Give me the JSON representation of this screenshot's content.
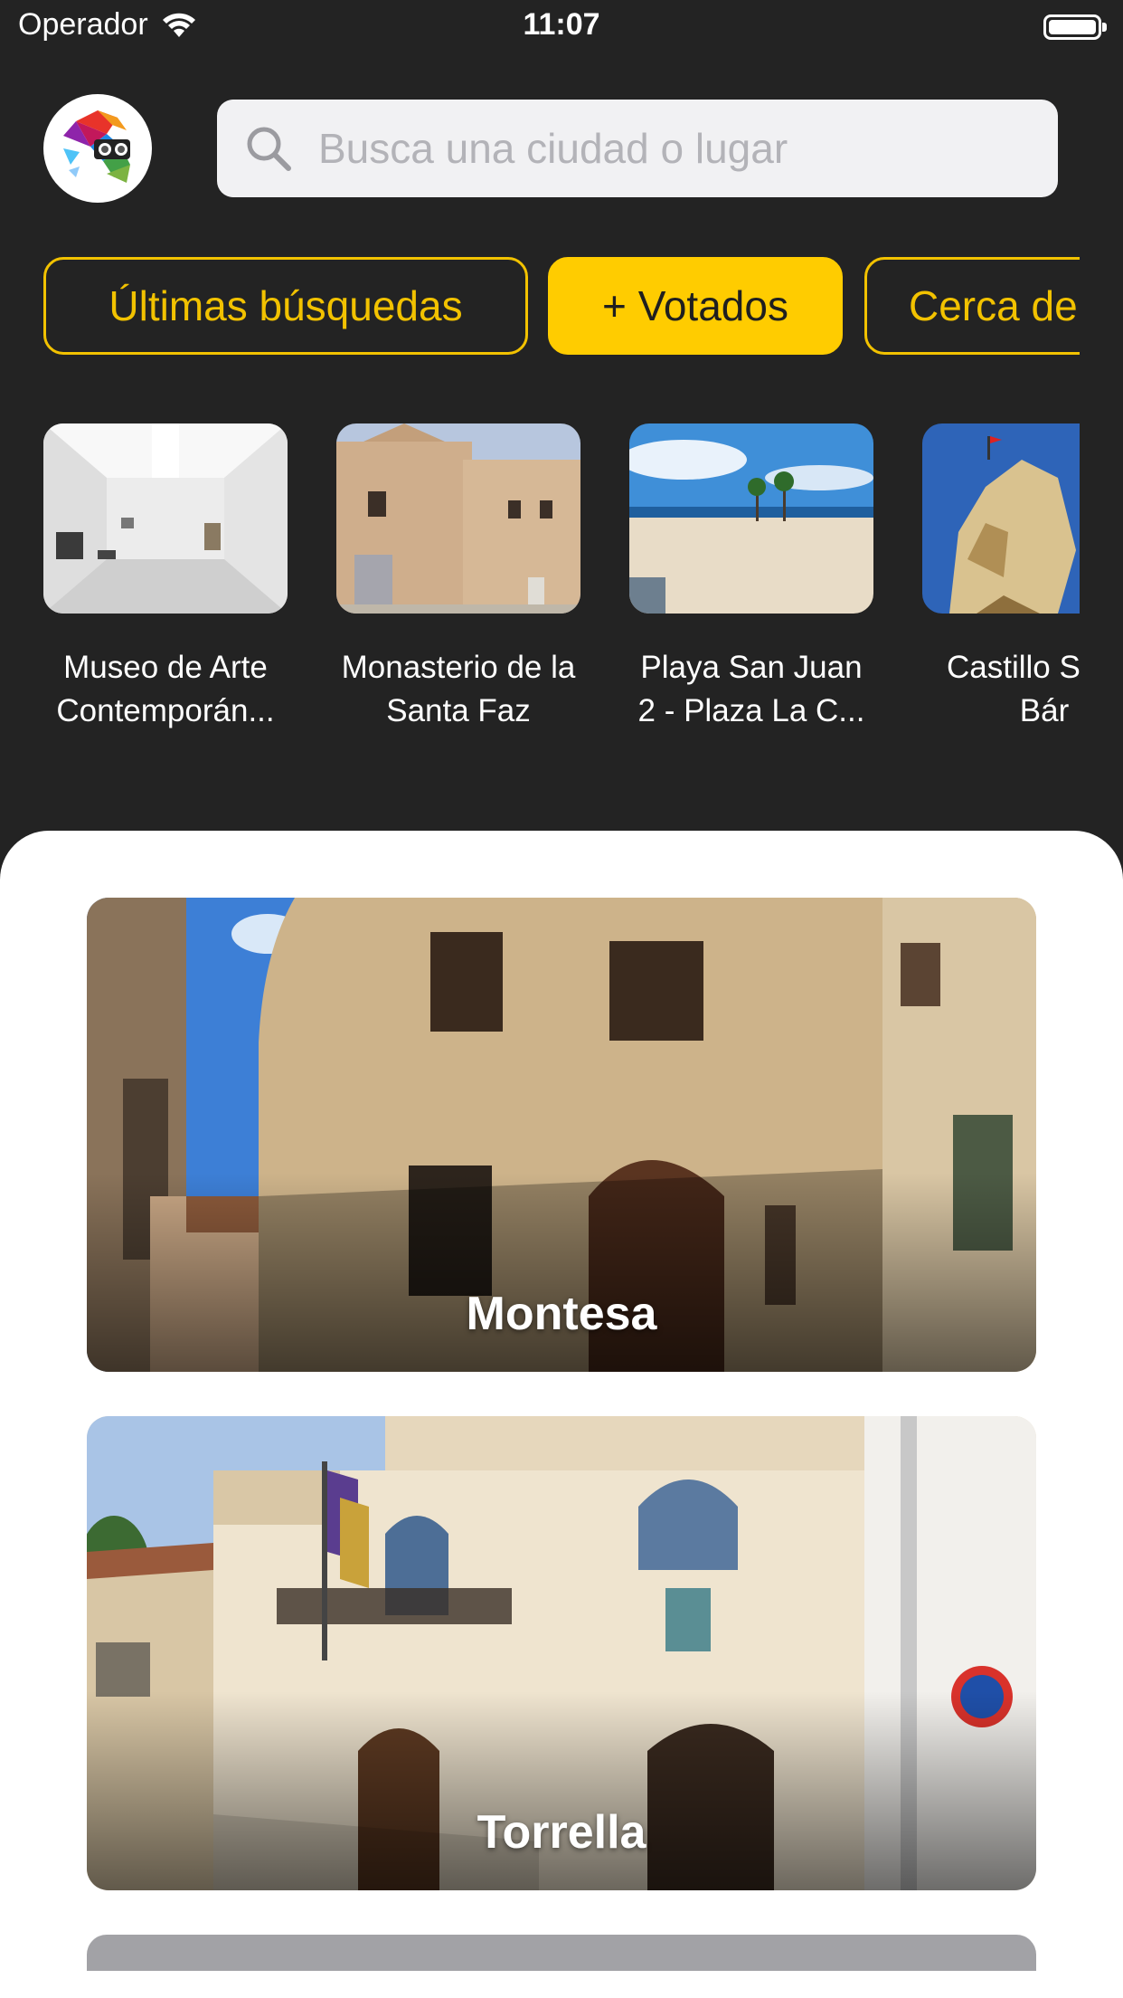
{
  "status_bar": {
    "carrier": "Operador",
    "time": "11:07"
  },
  "search": {
    "placeholder": "Busca una ciudad o lugar"
  },
  "filters": [
    {
      "label": "Últimas búsquedas",
      "active": false
    },
    {
      "label": "+ Votados",
      "active": true
    },
    {
      "label": "Cerca de",
      "active": false
    }
  ],
  "places": [
    {
      "name": "Museo de Arte Contemporán..."
    },
    {
      "name": "Monasterio de la Santa Faz"
    },
    {
      "name": "Playa San Juan 2 - Plaza La C..."
    },
    {
      "name": "Castillo Santa Bár"
    }
  ],
  "cities": [
    {
      "name": "Montesa"
    },
    {
      "name": "Torrella"
    }
  ],
  "colors": {
    "accent": "#ffcc00",
    "background": "#232323",
    "sheet": "#ffffff"
  }
}
